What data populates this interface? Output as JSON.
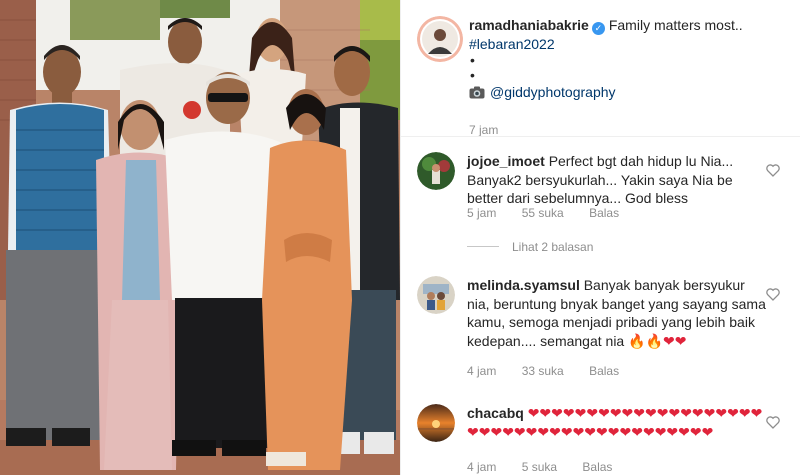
{
  "post": {
    "username": "ramadhaniabakrie",
    "caption_text": "Family matters most..",
    "hashtag": "#lebaran2022",
    "bullet1": "•",
    "bullet2": "•",
    "mention": "@giddyphotography",
    "time": "7 jam"
  },
  "icons": {
    "verified": "verified-badge-icon",
    "camera": "camera-icon",
    "heart": "heart-outline-icon"
  },
  "colors": {
    "link": "#00376b",
    "verified": "#3897f0",
    "meta": "#8e8e8e",
    "heart_emoji": "#e0243b"
  },
  "comments": [
    {
      "username": "jojoe_imoet",
      "text": "Perfect bgt dah hidup lu Nia... Banyak2 bersyukurlah... Yakin saya Nia be better dari sebelumnya... God bless",
      "time": "5 jam",
      "likes": "55 suka",
      "reply": "Balas",
      "view_replies": "Lihat 2 balasan"
    },
    {
      "username": "melinda.syamsul",
      "text": "Banyak banyak bersyukur nia, beruntung bnyak banget yang sayang sama kamu, semoga menjadi pribadi yang lebih baik kedepan.... semangat nia",
      "emojis": "🔥🔥❤❤",
      "time": "4 jam",
      "likes": "33 suka",
      "reply": "Balas"
    },
    {
      "username": "chacabq",
      "emojis": "❤❤❤❤❤❤❤❤❤❤❤❤❤❤❤❤❤❤❤❤❤❤❤❤❤❤❤❤❤❤❤❤❤❤❤❤❤❤❤❤❤",
      "time": "4 jam",
      "likes": "5 suka",
      "reply": "Balas"
    }
  ]
}
